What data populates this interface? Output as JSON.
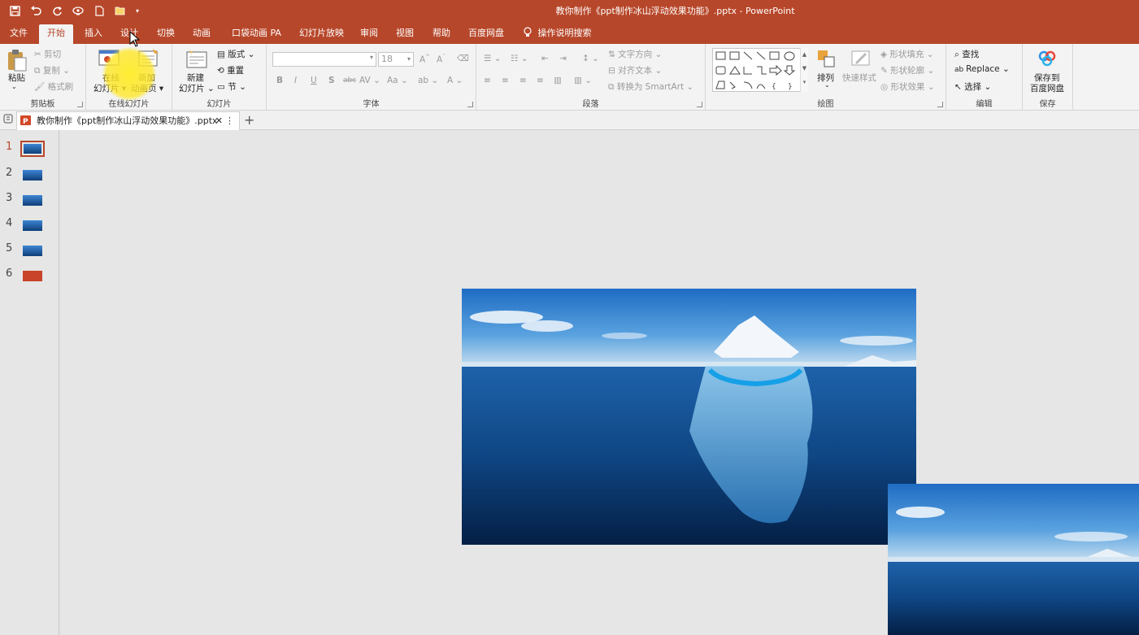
{
  "window": {
    "title": "教你制作《ppt制作冰山浮动效果功能》.pptx  -  PowerPoint"
  },
  "quick_access": {
    "icons": [
      "save-icon",
      "undo-icon",
      "redo-icon",
      "presenter-icon",
      "new-file-icon",
      "open-folder-icon",
      "customize-qat-icon"
    ]
  },
  "tabs": [
    {
      "label": "文件"
    },
    {
      "label": "开始"
    },
    {
      "label": "插入"
    },
    {
      "label": "设计"
    },
    {
      "label": "切换"
    },
    {
      "label": "动画"
    },
    {
      "label": "口袋动画 PA"
    },
    {
      "label": "幻灯片放映"
    },
    {
      "label": "审阅"
    },
    {
      "label": "视图"
    },
    {
      "label": "帮助"
    },
    {
      "label": "百度网盘"
    },
    {
      "label": "操作说明搜索"
    }
  ],
  "active_tab": "开始",
  "ribbon": {
    "clipboard": {
      "paste": "粘贴",
      "cut": "剪切",
      "copy": "复制",
      "format_painter": "格式刷",
      "label": "剪贴板"
    },
    "online_slides": {
      "online": "在线",
      "online2": "幻灯片",
      "new_anim": "新加",
      "new_anim2": "动画页",
      "label": "在线幻灯片"
    },
    "slides": {
      "new_slide": "新建",
      "new_slide2": "幻灯片",
      "layout": "版式",
      "reset": "重置",
      "section": "节",
      "label": "幻灯片"
    },
    "font": {
      "size": "18",
      "label": "字体"
    },
    "paragraph": {
      "text_direction": "文字方向",
      "align_text": "对齐文本",
      "smartart": "转换为 SmartArt",
      "label": "段落"
    },
    "drawing": {
      "arrange": "排列",
      "quick_styles": "快速样式",
      "shape_fill": "形状填充",
      "shape_outline": "形状轮廓",
      "shape_effects": "形状效果",
      "label": "绘图"
    },
    "editing": {
      "find": "查找",
      "replace": "Replace",
      "select": "选择",
      "label": "编辑"
    },
    "save": {
      "save_to": "保存到",
      "baidu": "百度网盘",
      "label": "保存"
    }
  },
  "doc_tab": {
    "name": "教你制作《ppt制作冰山浮动效果功能》.pptx"
  },
  "slides": [
    {
      "num": "1",
      "theme": "sea"
    },
    {
      "num": "2",
      "theme": "sea"
    },
    {
      "num": "3",
      "theme": "sea"
    },
    {
      "num": "4",
      "theme": "sea"
    },
    {
      "num": "5",
      "theme": "sea"
    },
    {
      "num": "6",
      "theme": "red"
    }
  ],
  "colors": {
    "accent": "#b7472a",
    "background": "#e6e6e6"
  }
}
